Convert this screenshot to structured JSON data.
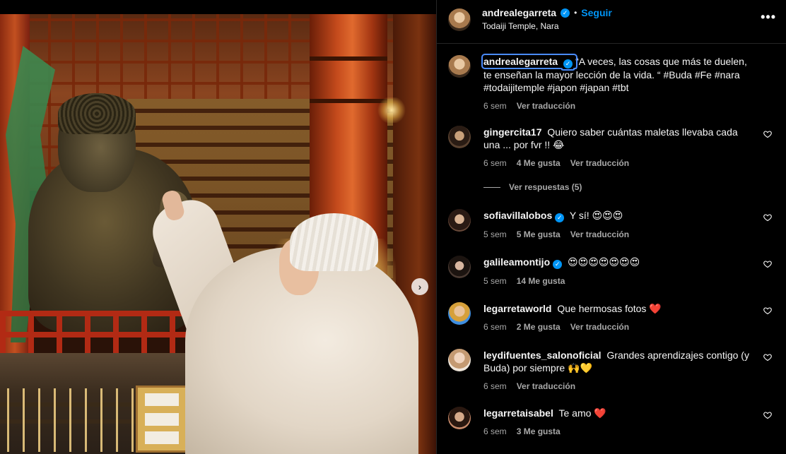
{
  "post": {
    "username": "andrealegarreta",
    "follow_label": "Seguir",
    "dot": "•",
    "location": "Todaiji Temple, Nara",
    "more_label": "•••",
    "next_icon_glyph": "›"
  },
  "caption": {
    "username": "andrealegarreta",
    "text": "“A veces, las cosas que más te duelen, te enseñan la mayor lección de la vida. “ #Buda #Fe #nara #todaijitemple #japon #japan #tbt",
    "time": "6 sem",
    "translate": "Ver traducción"
  },
  "comments": [
    {
      "username": "gingercita17",
      "verified": false,
      "text": "Quiero saber cuántas maletas llevaba cada una ... por fvr !! 😂",
      "time": "6 sem",
      "likes": "4 Me gusta",
      "translate": "Ver traducción"
    },
    {
      "username": "sofiavillalobos",
      "verified": true,
      "text": "Y sí! 😍😍😍",
      "time": "5 sem",
      "likes": "5 Me gusta",
      "translate": "Ver traducción"
    },
    {
      "username": "galileamontijo",
      "verified": true,
      "text": "😍😍😍😍😍😍😍",
      "time": "5 sem",
      "likes": "14 Me gusta",
      "translate": ""
    },
    {
      "username": "legarretaworld",
      "verified": false,
      "text": "Que hermosas fotos ❤️",
      "time": "6 sem",
      "likes": "2 Me gusta",
      "translate": "Ver traducción"
    },
    {
      "username": "leydifuentes_salonoficial",
      "verified": false,
      "text": "Grandes aprendizajes contigo (y Buda) por siempre 🙌💛",
      "time": "6 sem",
      "likes": "",
      "translate": "Ver traducción"
    },
    {
      "username": "legarretaisabel",
      "verified": false,
      "text": "Te amo ❤️",
      "time": "6 sem",
      "likes": "3 Me gusta",
      "translate": ""
    }
  ],
  "view_replies": "Ver respuestas (5)",
  "icons": {
    "verified": "✓",
    "heart": "heart-outline-icon",
    "more": "more-horizontal-icon"
  },
  "colors": {
    "accent": "#0095f6",
    "background": "#000000",
    "secondary_text": "#a8a8a8"
  }
}
